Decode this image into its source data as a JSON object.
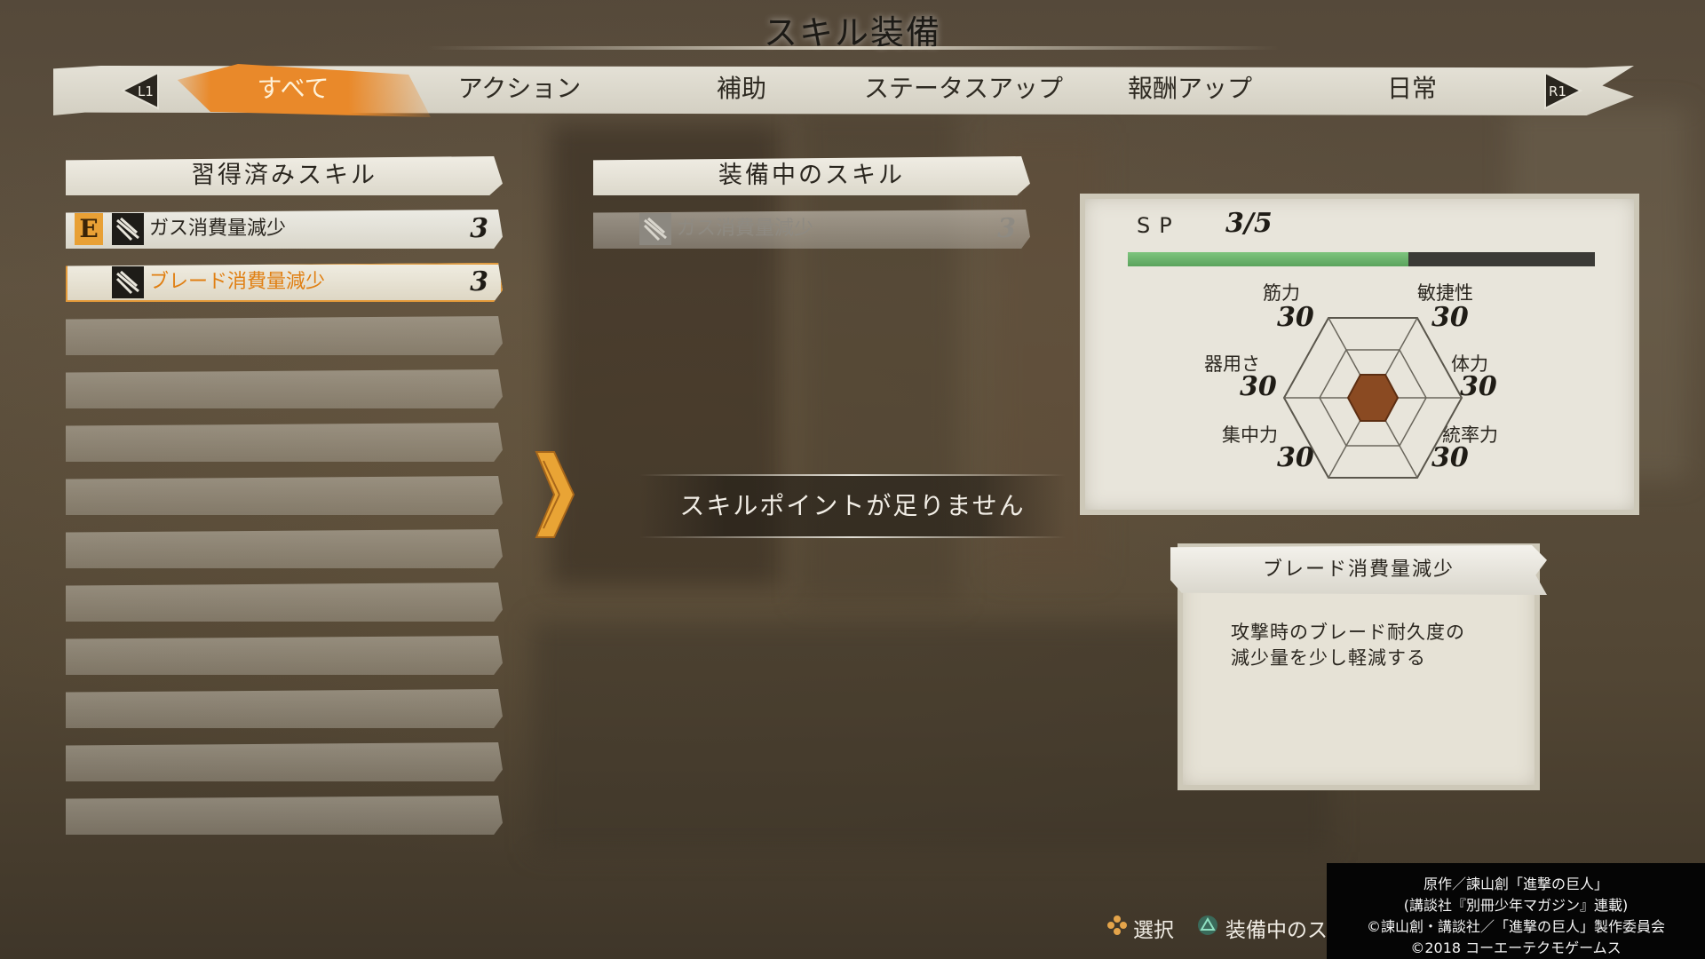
{
  "title": "スキル装備",
  "tabs": [
    "すべて",
    "アクション",
    "補助",
    "ステータスアップ",
    "報酬アップ",
    "日常"
  ],
  "active_tab": "すべて",
  "shoulder_left": "L1",
  "shoulder_right": "R1",
  "learned_panel": {
    "header": "習得済みスキル",
    "skills": [
      {
        "name": "ガス消費量減少",
        "cost": "3",
        "equipped_badge": "E"
      },
      {
        "name": "ブレード消費量減少",
        "cost": "3"
      }
    ]
  },
  "equipped_panel": {
    "header": "装備中のスキル",
    "skills": [
      {
        "name": "ガス消費量減少",
        "cost": "3"
      }
    ]
  },
  "message": "スキルポイントが足りません",
  "stats": {
    "sp_label": "SP",
    "sp_value": "3/5",
    "sp_fraction": 0.6,
    "strength_label": "筋力",
    "strength_value": "30",
    "agility_label": "敏捷性",
    "agility_value": "30",
    "dexterity_label": "器用さ",
    "dexterity_value": "30",
    "stamina_label": "体力",
    "stamina_value": "30",
    "focus_label": "集中力",
    "focus_value": "30",
    "leadership_label": "統率力",
    "leadership_value": "30"
  },
  "description": {
    "title": "ブレード消費量減少",
    "line1": "攻撃時のブレード耐久度の",
    "line2": "減少量を少し軽減する"
  },
  "hints": {
    "select_label": "選択",
    "remove_label": "装備中のス"
  },
  "copyright": {
    "line1": "原作／諫山創「進撃の巨人」",
    "line2": "(講談社『別冊少年マガジン』連載)",
    "line3": "©諫山創・講談社／「進撃の巨人」製作委員会",
    "line4": "©2018 コーエーテクモゲームス"
  },
  "colors": {
    "accent": "#e9892a",
    "sp_bar": "#6fb86f",
    "radar_fill": "#8a4a22"
  }
}
